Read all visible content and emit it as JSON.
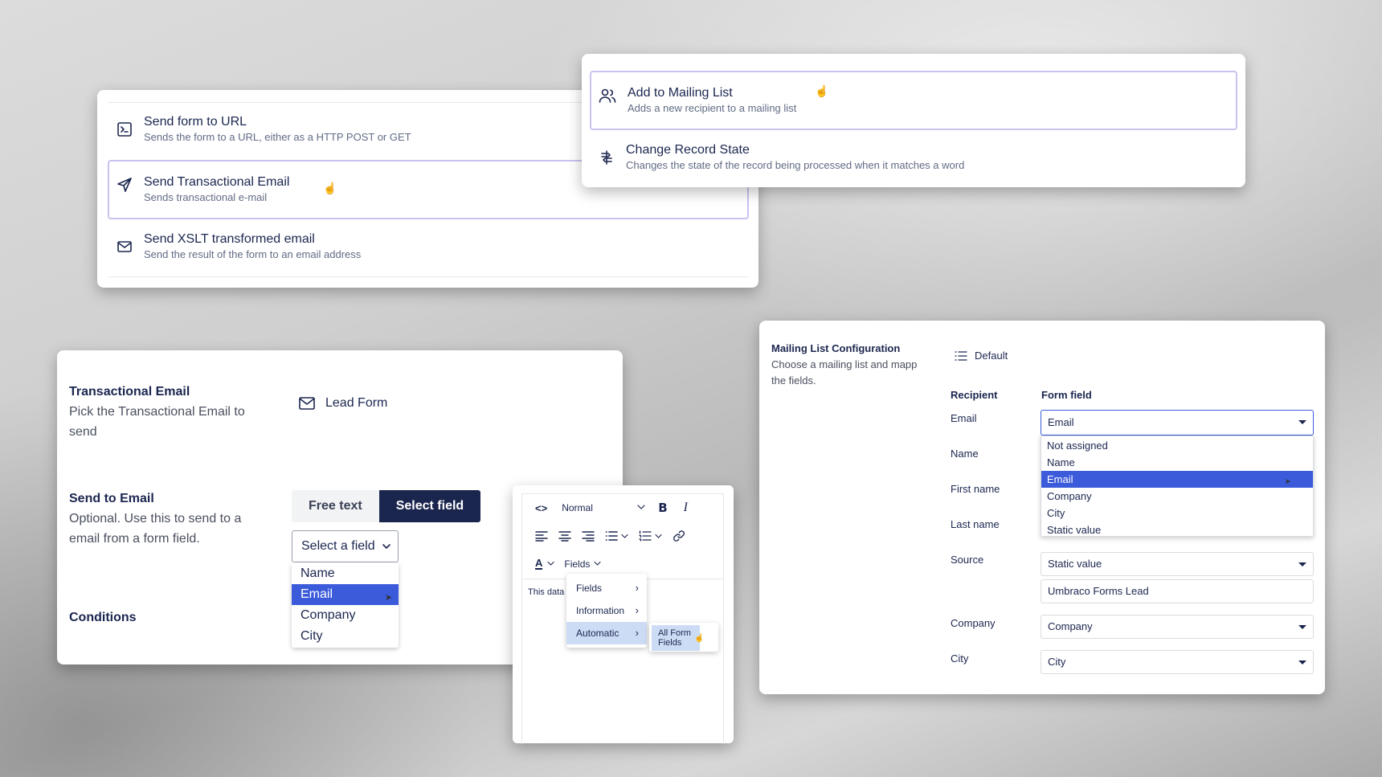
{
  "workflows_left": {
    "items": [
      {
        "title": "Send form to URL",
        "desc": "Sends the form to a URL, either as a HTTP POST or GET"
      },
      {
        "title": "Send Transactional Email",
        "desc": "Sends transactional e-mail"
      },
      {
        "title": "Send XSLT transformed email",
        "desc": "Send the result of the form to an email address"
      }
    ]
  },
  "workflows_right": {
    "items": [
      {
        "title": "Add to Mailing List",
        "desc": "Adds a new recipient to a mailing list"
      },
      {
        "title": "Change Record State",
        "desc": "Changes the state of the record being processed when it matches a word"
      }
    ]
  },
  "transactional": {
    "title": "Transactional Email",
    "desc": "Pick the Transactional Email to send",
    "picked_value": "Lead Form",
    "send_to_title": "Send to Email",
    "send_to_desc": "Optional. Use this to send to a email from a form field.",
    "toggle_free": "Free text",
    "toggle_select": "Select field",
    "select_placeholder": "Select a field",
    "options": [
      "Name",
      "Email",
      "Company",
      "City"
    ],
    "selected_option": "Email",
    "conditions": "Conditions"
  },
  "editor": {
    "format_select": "Normal",
    "bold": "B",
    "italic": "I",
    "color_label": "A",
    "fields_menu": "Fields",
    "content_text": "This data",
    "menu_items": [
      "Fields",
      "Information",
      "Automatic"
    ],
    "submenu_item": "All Form Fields"
  },
  "mailing": {
    "title": "Mailing List Configuration",
    "desc": "Choose a mailing list and mapp the fields.",
    "list_value": "Default",
    "col_recipient": "Recipient",
    "col_form_field": "Form field",
    "rows": [
      "Email",
      "Name",
      "First name",
      "Last name",
      "Source",
      "Company",
      "City"
    ],
    "email_value": "Email",
    "dropdown_options": [
      "Not assigned",
      "Name",
      "Email",
      "Company",
      "City",
      "Static value"
    ],
    "source_value": "Static value",
    "source_static_text": "Umbraco Forms Lead",
    "company_value": "Company",
    "city_value": "City"
  },
  "colors": {
    "navy": "#1b264f",
    "highlight": "#3b5bdb",
    "selected_border": "#c9c3f0"
  }
}
